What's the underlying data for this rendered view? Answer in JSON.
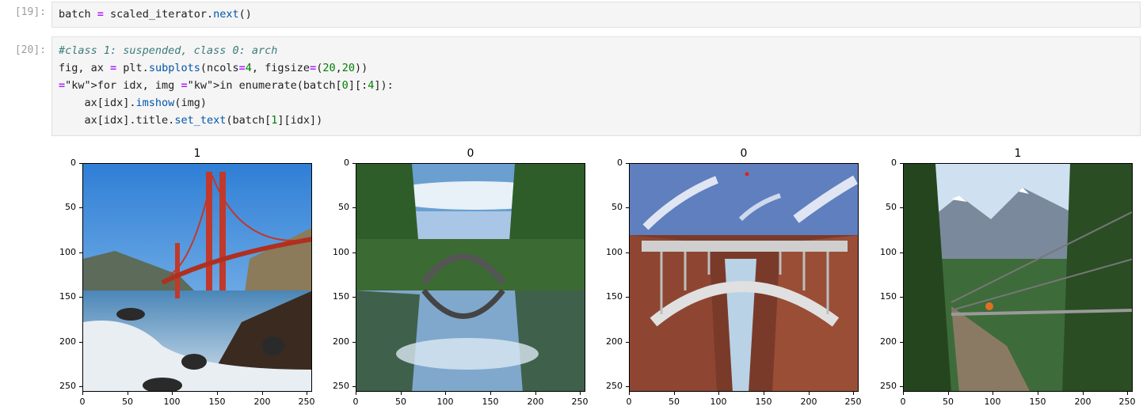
{
  "cells": [
    {
      "prompt": "[19]:",
      "lines": [
        "batch = scaled_iterator.next()"
      ]
    },
    {
      "prompt": "[20]:",
      "lines": [
        "#class 1: suspended, class 0: arch",
        "fig, ax = plt.subplots(ncols=4, figsize=(20,20))",
        "for idx, img in enumerate(batch[0][:4]):",
        "    ax[idx].imshow(img)",
        "    ax[idx].title.set_text(batch[1][idx])"
      ]
    }
  ],
  "figure": {
    "subplots": [
      {
        "title": "1",
        "image": "Golden Gate suspension bridge over rocky coastline"
      },
      {
        "title": "0",
        "image": "Stone arch bridge reflected in a forest lake"
      },
      {
        "title": "0",
        "image": "Blocky arch bridge spanning a red canyon"
      },
      {
        "title": "1",
        "image": "Pedestrian suspension bridge in a forested mountain valley"
      }
    ],
    "ytick_labels": [
      "0",
      "50",
      "100",
      "150",
      "200",
      "250"
    ],
    "xtick_labels": [
      "0",
      "50",
      "100",
      "150",
      "200",
      "250"
    ],
    "colors": {
      "sky": "#3b82d6",
      "bridge_red": "#c0392b",
      "forest": "#2f5d2a"
    }
  }
}
